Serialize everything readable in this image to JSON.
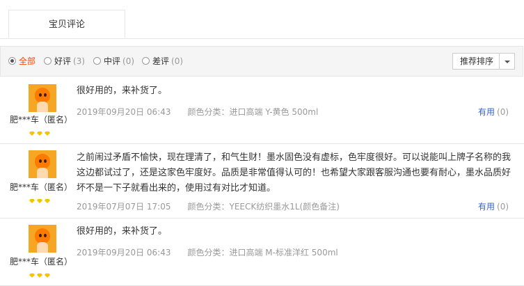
{
  "tabs": [
    {
      "label": "宝贝评论"
    }
  ],
  "filters": [
    {
      "label": "全部",
      "count": ""
    },
    {
      "label": "好评",
      "count": "(3)"
    },
    {
      "label": "中评",
      "count": "(0)"
    },
    {
      "label": "差评",
      "count": "(0)"
    }
  ],
  "sort": {
    "label": "推荐排序"
  },
  "reviews": [
    {
      "user": "肥***车（匿名）",
      "content": "很好用的，来补货了。",
      "date": "2019年09月20日 06:43",
      "spec": "颜色分类：进口高端 Y-黄色 500ml",
      "useful_label": "有用",
      "useful_count": "(0)"
    },
    {
      "user": "肥***车（匿名）",
      "content": "之前闹过矛盾不愉快，现在理清了，和气生财！墨水固色没有虚标，色牢度很好。可以说能叫上牌子名称的我这边都试过了，还是这家色牢度好。品质是非常值得认可的！也希望大家跟客服沟通也要有耐心，墨水品质好坏不是一下子就看出来的，使用过有对比才知道。",
      "date": "2019年07月07日 17:05",
      "spec": "颜色分类：YEECK纺织墨水1L(颜色备注)",
      "useful_label": "有用",
      "useful_count": "(0)"
    },
    {
      "user": "肥***车（匿名）",
      "content": "很好用的，来补货了。",
      "date": "2019年09月20日 06:43",
      "spec": "颜色分类：进口高端 M-标准洋红 500ml",
      "useful_label": "有用",
      "useful_count": "(0)"
    }
  ]
}
